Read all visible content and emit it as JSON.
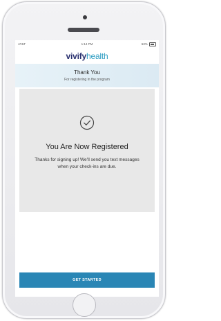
{
  "status_bar": {
    "carrier": "AT&T",
    "time": "1:14 PM",
    "battery": "63%"
  },
  "brand": {
    "logo_part1": "vivify",
    "logo_part2": "health"
  },
  "header": {
    "title": "Thank You",
    "subtitle": "For registering in the program"
  },
  "card": {
    "icon": "check-circle-icon",
    "title": "You Are Now Registered",
    "body": "Thanks for signing up! We'll send you text messages when your check-ins are due."
  },
  "actions": {
    "get_started_label": "GET STARTED"
  },
  "colors": {
    "brand_navy": "#29306f",
    "brand_teal": "#2f9ec3",
    "button_blue": "#2a86b5",
    "header_band": "#e0eef6",
    "card_grey": "#e8e8e8"
  }
}
